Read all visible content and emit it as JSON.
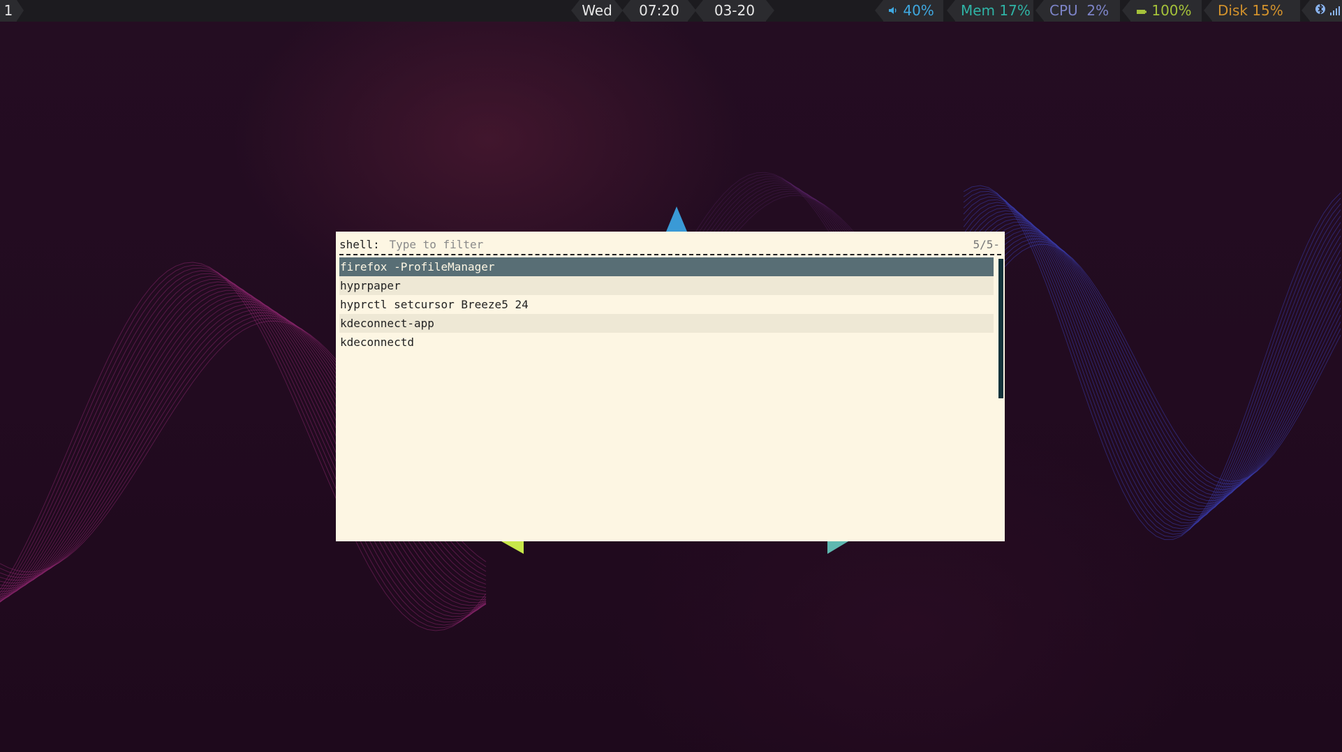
{
  "topbar": {
    "workspace": "1",
    "day": "Wed",
    "time": "07:20",
    "date": "03-20",
    "volume": "40%",
    "memory": "Mem 17%",
    "cpu": "CPU  2%",
    "battery": "100%",
    "disk": "Disk 15%"
  },
  "launcher": {
    "prompt": "shell:",
    "placeholder": "Type to filter",
    "filter_value": "",
    "counter": "5/5-",
    "items": [
      "firefox -ProfileManager",
      "hyprpaper",
      "hyprctl setcursor Breeze5 24",
      "kdeconnect-app",
      "kdeconnectd"
    ]
  },
  "icons": {
    "volume": "speaker-icon",
    "battery": "battery-icon",
    "bluetooth": "bluetooth-icon",
    "network": "signal-icon"
  },
  "colors": {
    "launcher_bg": "#fdf6e3",
    "selected_bg": "#586e75",
    "alt_row_bg": "#eee8d5",
    "volume": "#3fa8e0",
    "memory": "#2fb3a5",
    "cpu": "#7d84c8",
    "battery": "#a5c23a",
    "disk": "#d3922c"
  }
}
